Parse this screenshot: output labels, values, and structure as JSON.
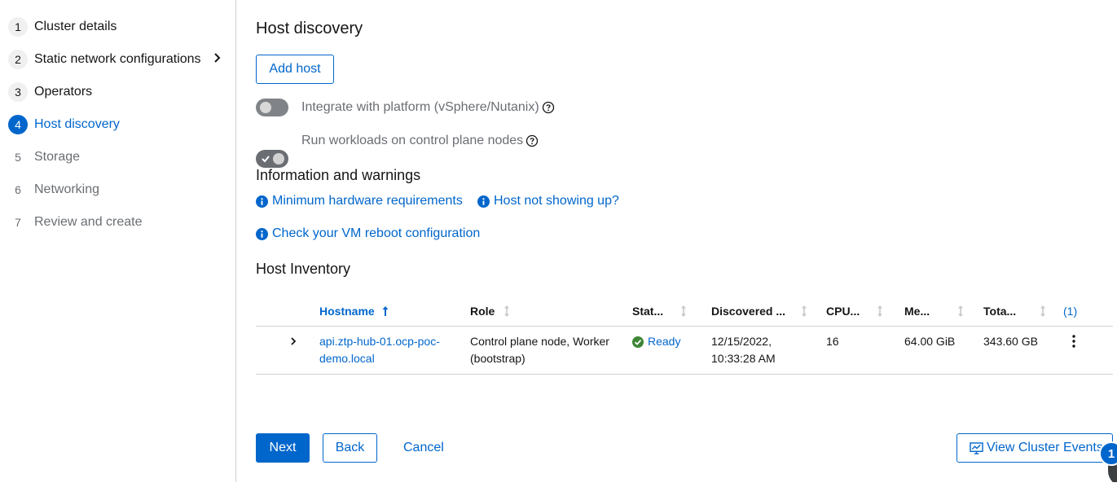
{
  "nav": {
    "steps": [
      {
        "num": "1",
        "label": "Cluster details"
      },
      {
        "num": "2",
        "label": "Static network configurations"
      },
      {
        "num": "3",
        "label": "Operators"
      },
      {
        "num": "4",
        "label": "Host discovery"
      },
      {
        "num": "5",
        "label": "Storage"
      },
      {
        "num": "6",
        "label": "Networking"
      },
      {
        "num": "7",
        "label": "Review and create"
      }
    ]
  },
  "page": {
    "title": "Host discovery",
    "add_host": "Add host"
  },
  "toggles": {
    "integrate_label": "Integrate with platform (vSphere/Nutanix)",
    "integrate_on": false,
    "workloads_label": "Run workloads on control plane nodes",
    "workloads_on": true
  },
  "info": {
    "title": "Information and warnings",
    "min_hw": "Minimum hardware requirements",
    "host_not_showing": "Host not showing up?",
    "vm_reboot": "Check your VM reboot configuration"
  },
  "inventory": {
    "title": "Host Inventory",
    "columns": [
      "Hostname",
      "Role",
      "Stat...",
      "Discovered ...",
      "CPU...",
      "Me...",
      "Tota...",
      "(1)"
    ],
    "rows": [
      {
        "hostname_line1": "api.ztp-hub-01.ocp-poc-",
        "hostname_line2": "demo.local",
        "role_line1": "Control plane node, Worker",
        "role_line2": "(bootstrap)",
        "status": "Ready",
        "discovered_line1": "12/15/2022,",
        "discovered_line2": "10:33:28 AM",
        "cpu": "16",
        "memory": "64.00 GiB",
        "total": "343.60 GB"
      }
    ]
  },
  "footer": {
    "next": "Next",
    "back": "Back",
    "cancel": "Cancel",
    "view_events": "View Cluster Events",
    "badge": "1"
  },
  "colors": {
    "accent": "#0066cc",
    "success": "#3e8635"
  }
}
